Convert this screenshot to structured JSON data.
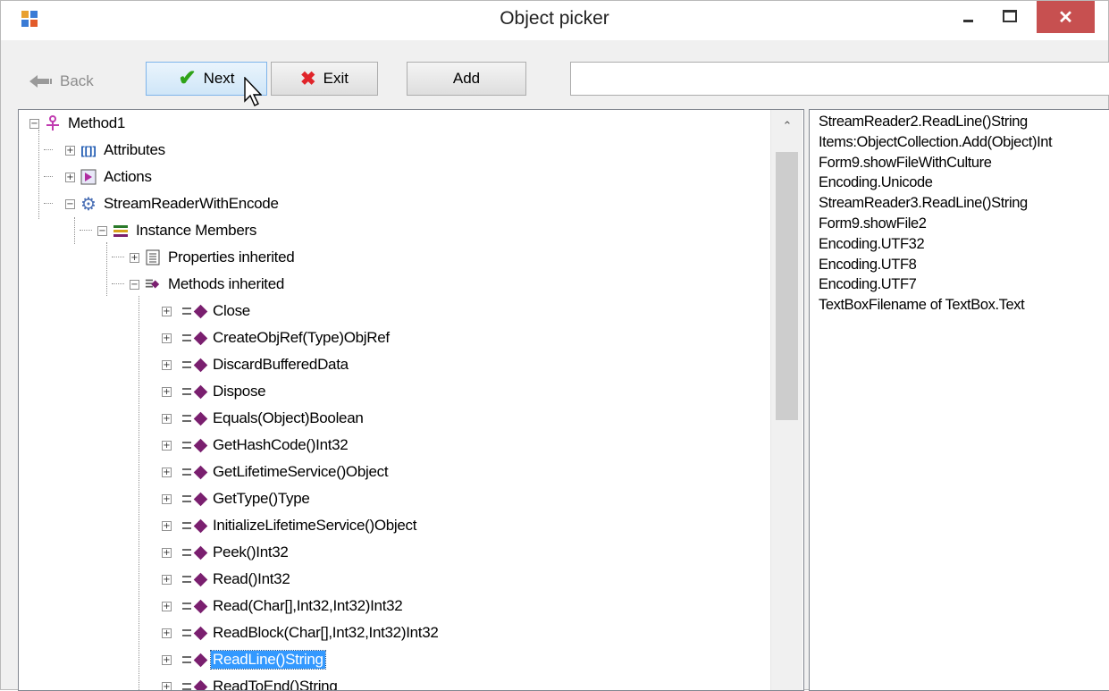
{
  "window": {
    "title": "Object picker"
  },
  "toolbar": {
    "back_label": "Back",
    "next_label": "Next",
    "exit_label": "Exit",
    "add_label": "Add",
    "path_value": ""
  },
  "tree": {
    "root": "Method1",
    "attributes": "Attributes",
    "actions": "Actions",
    "stream_reader": "StreamReaderWithEncode",
    "instance_members": "Instance Members",
    "properties_inherited": "Properties inherited",
    "methods_inherited": "Methods inherited",
    "methods": [
      "Close",
      "CreateObjRef(Type)ObjRef",
      "DiscardBufferedData",
      "Dispose",
      "Equals(Object)Boolean",
      "GetHashCode()Int32",
      "GetLifetimeService()Object",
      "GetType()Type",
      "InitializeLifetimeService()Object",
      "Peek()Int32",
      "Read()Int32",
      "Read(Char[],Int32,Int32)Int32",
      "ReadBlock(Char[],Int32,Int32)Int32",
      "ReadLine()String",
      "ReadToEnd()String"
    ],
    "selected": "ReadLine()String"
  },
  "list": {
    "items": [
      "StreamReader2.ReadLine()String",
      "Items:ObjectCollection.Add(Object)Int",
      "Form9.showFileWithCulture",
      "Encoding.Unicode",
      "StreamReader3.ReadLine()String",
      "Form9.showFile2",
      "Encoding.UTF32",
      "Encoding.UTF8",
      "Encoding.UTF7",
      "TextBoxFilename of TextBox.Text"
    ]
  },
  "colors": {
    "selection": "#3399ff",
    "close_button": "#c75050",
    "method_icon": "#7a1f6f"
  }
}
